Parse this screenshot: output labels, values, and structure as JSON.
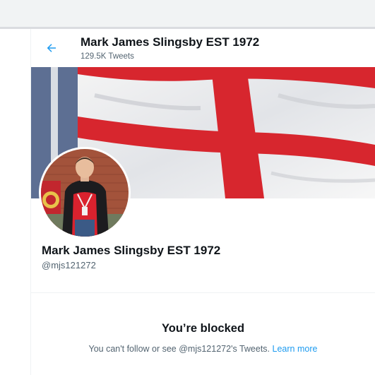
{
  "header": {
    "title": "Mark James Slingsby EST 1972",
    "tweet_count": "129.5K Tweets"
  },
  "profile": {
    "name": "Mark James Slingsby EST 1972",
    "handle": "@mjs121272"
  },
  "blocked": {
    "title": "You’re blocked",
    "message": "You can't follow or see @mjs121272's Tweets.",
    "link": "Learn more"
  },
  "icons": {
    "back": "back-arrow-icon"
  },
  "colors": {
    "accent": "#1d9bf0",
    "text": "#0f1419",
    "muted": "#536471",
    "flag_red": "#d7262e"
  }
}
